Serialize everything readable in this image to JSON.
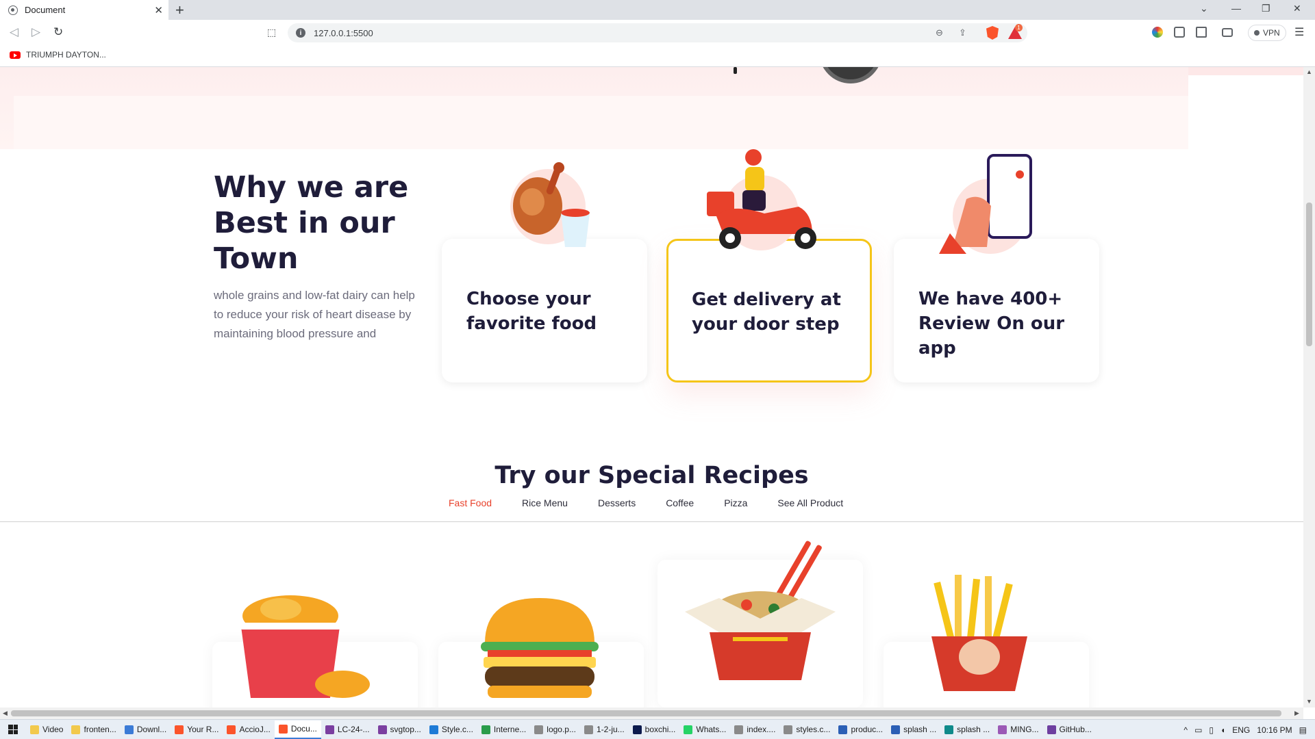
{
  "browser": {
    "tab_title": "Document",
    "tab_close": "✕",
    "new_tab": "+",
    "url": "127.0.0.1:5500",
    "vpn_label": "VPN",
    "rewards_badge": "1",
    "bookmark": "TRIUMPH DAYTON..."
  },
  "page": {
    "why": {
      "title": "Why we are Best in our Town",
      "text": "whole grains and low-fat dairy can help to reduce your risk of heart disease by maintaining blood pressure and"
    },
    "cards": [
      {
        "title": "Choose your favorite food",
        "icon": "fried-chicken-icon",
        "featured": false
      },
      {
        "title": "Get delivery at your door step",
        "icon": "delivery-scooter-icon",
        "featured": true
      },
      {
        "title": "We have 400+ Review On our app",
        "icon": "phone-review-icon",
        "featured": false
      }
    ],
    "recipes": {
      "title": "Try our Special Recipes",
      "tabs": [
        "Fast Food",
        "Rice Menu",
        "Desserts",
        "Coffee",
        "Pizza",
        "See All Product"
      ],
      "active_tab": "Fast Food",
      "foods": [
        "fried-chicken-bucket",
        "burger",
        "noodle-box",
        "french-fries"
      ]
    }
  },
  "taskbar": {
    "items": [
      {
        "label": "Video",
        "color": "#f2c94c"
      },
      {
        "label": "fronten...",
        "color": "#f2c94c"
      },
      {
        "label": "Downl...",
        "color": "#3b7bd6"
      },
      {
        "label": "Your R...",
        "color": "#fb542b"
      },
      {
        "label": "AccioJ...",
        "color": "#fb542b"
      },
      {
        "label": "Docu...",
        "color": "#fb542b"
      },
      {
        "label": "LC-24-...",
        "color": "#7b3fa0"
      },
      {
        "label": "svgtop...",
        "color": "#7b3fa0"
      },
      {
        "label": "Style.c...",
        "color": "#1e7bd6"
      },
      {
        "label": "Interne...",
        "color": "#2a9d4b"
      },
      {
        "label": "logo.p...",
        "color": "#8a8a8a"
      },
      {
        "label": "1-2-ju...",
        "color": "#8a8a8a"
      },
      {
        "label": "boxchi...",
        "color": "#0d1b4d"
      },
      {
        "label": "Whats...",
        "color": "#25d366"
      },
      {
        "label": "index....",
        "color": "#8a8a8a"
      },
      {
        "label": "styles.c...",
        "color": "#8a8a8a"
      },
      {
        "label": "produc...",
        "color": "#2b5fb5"
      },
      {
        "label": "splash ...",
        "color": "#2b5fb5"
      },
      {
        "label": "splash ...",
        "color": "#0f8a8a"
      },
      {
        "label": "MING...",
        "color": "#9b59b6"
      },
      {
        "label": "GitHub...",
        "color": "#6e3fa0"
      }
    ],
    "active_index": 5,
    "lang": "ENG",
    "time": "10:16 PM"
  },
  "colors": {
    "accent": "#e8412b",
    "featured_border": "#f5c518",
    "heading": "#1f1d3a"
  }
}
